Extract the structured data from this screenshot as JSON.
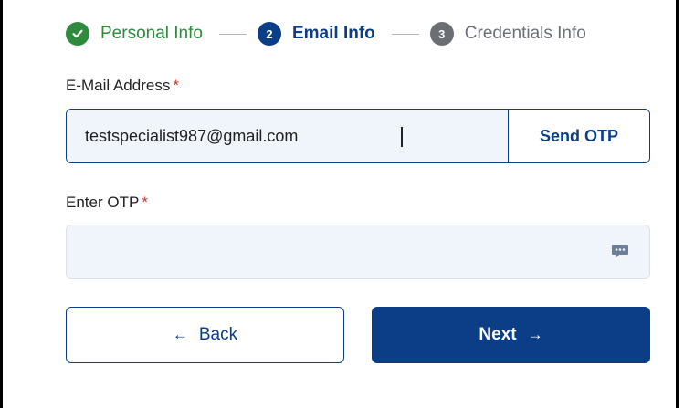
{
  "stepper": {
    "steps": [
      {
        "label": "Personal Info",
        "state": "done",
        "number": ""
      },
      {
        "label": "Email Info",
        "state": "active",
        "number": "2"
      },
      {
        "label": "Credentials Info",
        "state": "todo",
        "number": "3"
      }
    ]
  },
  "form": {
    "email_label": "E-Mail Address",
    "email_required": "*",
    "email_value": "testspecialist987@gmail.com",
    "send_otp_label": "Send OTP",
    "otp_label": "Enter OTP",
    "otp_required": "*",
    "otp_value": "",
    "otp_icon": "message-dots-icon"
  },
  "actions": {
    "back_label": "Back",
    "back_arrow": "←",
    "next_label": "Next",
    "next_arrow": "→"
  },
  "colors": {
    "primary": "#0b3e86",
    "success": "#2e8b3e",
    "inactive": "#6b6f74",
    "required": "#d0312d",
    "input_bg": "#f0f5fb"
  }
}
